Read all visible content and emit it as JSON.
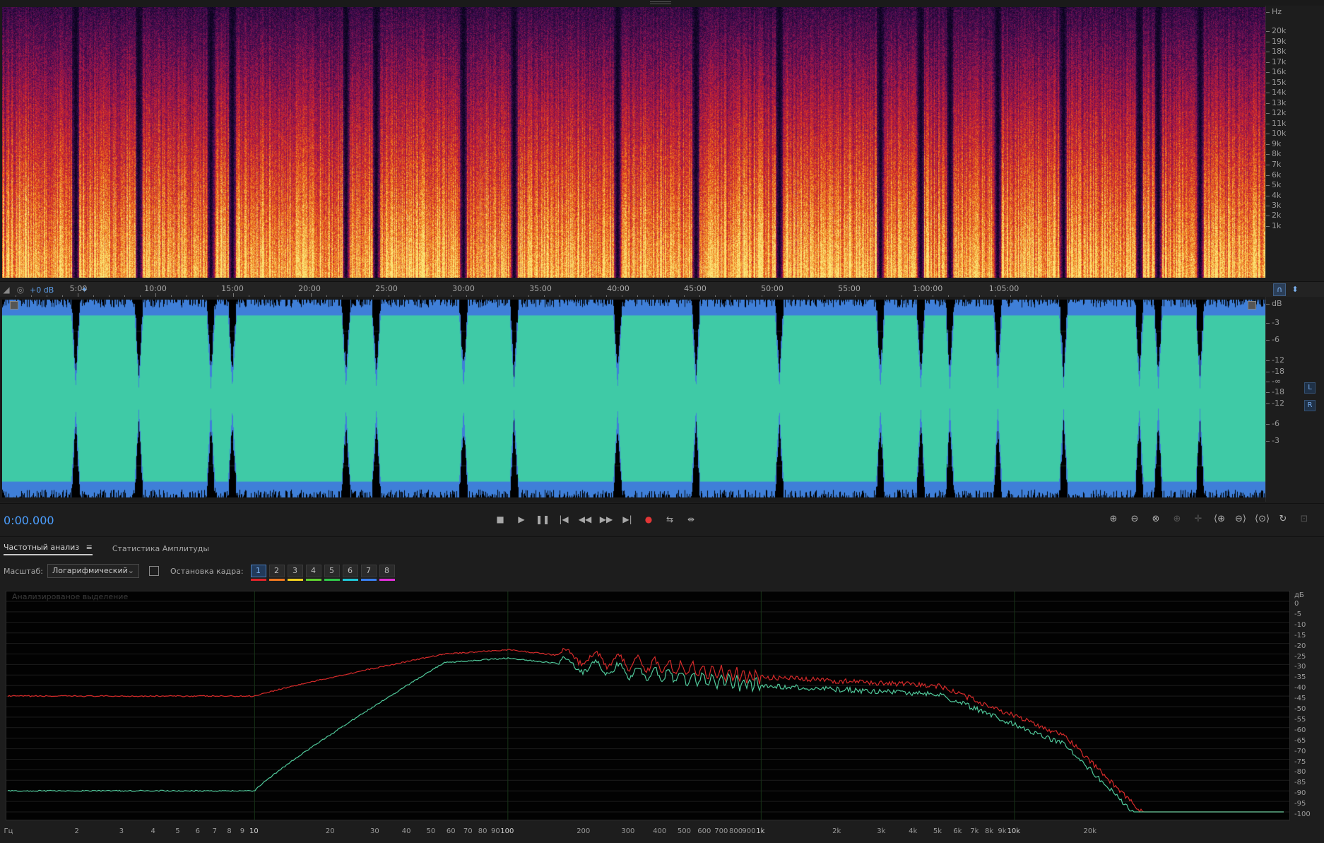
{
  "spectral": {
    "hz_unit": "Hz",
    "hz_ticks": [
      "20k",
      "19k",
      "18k",
      "17k",
      "16k",
      "15k",
      "14k",
      "13k",
      "12k",
      "11k",
      "10k",
      "9k",
      "8k",
      "7k",
      "6k",
      "5k",
      "4k",
      "3k",
      "2k",
      "1k"
    ]
  },
  "timeline": {
    "gain": "+0 dB",
    "ticks": [
      "5:00",
      "10:00",
      "15:00",
      "20:00",
      "25:00",
      "30:00",
      "35:00",
      "40:00",
      "45:00",
      "50:00",
      "55:00",
      "1:00:00",
      "1:05:00"
    ]
  },
  "waveform": {
    "db_unit": "dB",
    "db_ticks": [
      "-3",
      "-6",
      "-12",
      "-18",
      "-∞",
      "-18",
      "-12",
      "-6",
      "-3"
    ],
    "channels": [
      "L",
      "R"
    ],
    "colors": {
      "background": "#000000",
      "fill": "#3fcaa6",
      "peak": "#3f7fd8"
    }
  },
  "transport": {
    "current_time": "0:00.000"
  },
  "analysis": {
    "tabs": [
      "Частотный анализ",
      "Статистика Амплитуды"
    ],
    "active_tab": 0,
    "scale_label": "Масштаб:",
    "scale_value": "Логарифмический",
    "freeze_label": "Остановка кадра:",
    "frames": [
      "1",
      "2",
      "3",
      "4",
      "5",
      "6",
      "7",
      "8"
    ],
    "frame_colors": [
      "#e0242a",
      "#f07820",
      "#f2d020",
      "#5fd030",
      "#30c84a",
      "#20c8d8",
      "#3a80f0",
      "#e030d8"
    ],
    "graph_title": "Анализированое выделение",
    "db_unit": "дБ",
    "db_ticks": [
      "0",
      "-5",
      "-10",
      "-15",
      "-20",
      "-25",
      "-30",
      "-35",
      "-40",
      "-45",
      "-50",
      "-55",
      "-60",
      "-65",
      "-70",
      "-75",
      "-80",
      "-85",
      "-90",
      "-95",
      "-100"
    ],
    "freq_unit": "Гц",
    "freq_ticks": [
      "2",
      "3",
      "4",
      "5",
      "6",
      "7",
      "8",
      "9",
      "10",
      "20",
      "30",
      "40",
      "50",
      "60",
      "70",
      "80",
      "90",
      "100",
      "200",
      "300",
      "400",
      "500",
      "600",
      "700",
      "800",
      "900",
      "1k",
      "2k",
      "3k",
      "4k",
      "5k",
      "6k",
      "7k",
      "8k",
      "9k",
      "10k",
      "20k"
    ],
    "series_colors": [
      "#d42a2a",
      "#50c89a"
    ]
  }
}
